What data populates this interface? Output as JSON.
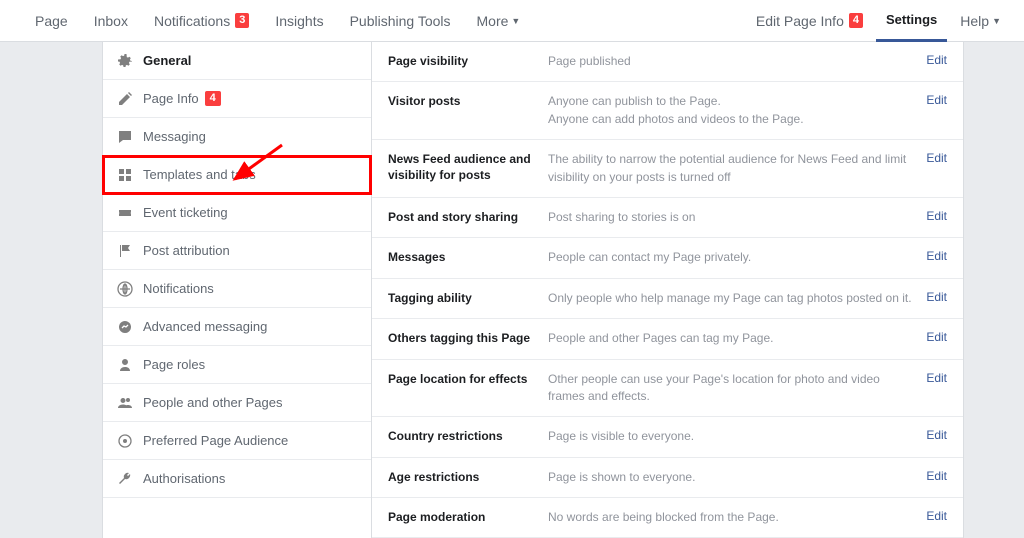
{
  "topnav": {
    "left": [
      {
        "label": "Page"
      },
      {
        "label": "Inbox"
      },
      {
        "label": "Notifications",
        "badge": "3"
      },
      {
        "label": "Insights"
      },
      {
        "label": "Publishing Tools"
      },
      {
        "label": "More",
        "caret": true
      }
    ],
    "right": [
      {
        "label": "Edit Page Info",
        "badge": "4"
      },
      {
        "label": "Settings",
        "active": true
      },
      {
        "label": "Help",
        "caret": true
      }
    ]
  },
  "sidebar": [
    {
      "icon": "gear",
      "label": "General",
      "active": true
    },
    {
      "icon": "pencil",
      "label": "Page Info",
      "badge": "4"
    },
    {
      "icon": "chat",
      "label": "Messaging"
    },
    {
      "icon": "grid",
      "label": "Templates and tabs",
      "highlight": true
    },
    {
      "icon": "ticket",
      "label": "Event ticketing"
    },
    {
      "icon": "flag",
      "label": "Post attribution"
    },
    {
      "icon": "globe",
      "label": "Notifications"
    },
    {
      "icon": "messenger",
      "label": "Advanced messaging"
    },
    {
      "icon": "person",
      "label": "Page roles"
    },
    {
      "icon": "people",
      "label": "People and other Pages"
    },
    {
      "icon": "audience",
      "label": "Preferred Page Audience"
    },
    {
      "icon": "wrench",
      "label": "Authorisations"
    }
  ],
  "rows": [
    {
      "label": "Page visibility",
      "desc": "Page published",
      "edit": "Edit"
    },
    {
      "label": "Visitor posts",
      "desc": "Anyone can publish to the Page.\nAnyone can add photos and videos to the Page.",
      "edit": "Edit"
    },
    {
      "label": "News Feed audience and visibility for posts",
      "desc": "The ability to narrow the potential audience for News Feed and limit visibility on your posts is turned off",
      "edit": "Edit"
    },
    {
      "label": "Post and story sharing",
      "desc": "Post sharing to stories is on",
      "edit": "Edit"
    },
    {
      "label": "Messages",
      "desc": "People can contact my Page privately.",
      "edit": "Edit"
    },
    {
      "label": "Tagging ability",
      "desc": "Only people who help manage my Page can tag photos posted on it.",
      "edit": "Edit"
    },
    {
      "label": "Others tagging this Page",
      "desc": "People and other Pages can tag my Page.",
      "edit": "Edit"
    },
    {
      "label": "Page location for effects",
      "desc": "Other people can use your Page's location for photo and video frames and effects.",
      "edit": "Edit"
    },
    {
      "label": "Country restrictions",
      "desc": "Page is visible to everyone.",
      "edit": "Edit"
    },
    {
      "label": "Age restrictions",
      "desc": "Page is shown to everyone.",
      "edit": "Edit"
    },
    {
      "label": "Page moderation",
      "desc": "No words are being blocked from the Page.",
      "edit": "Edit"
    }
  ]
}
